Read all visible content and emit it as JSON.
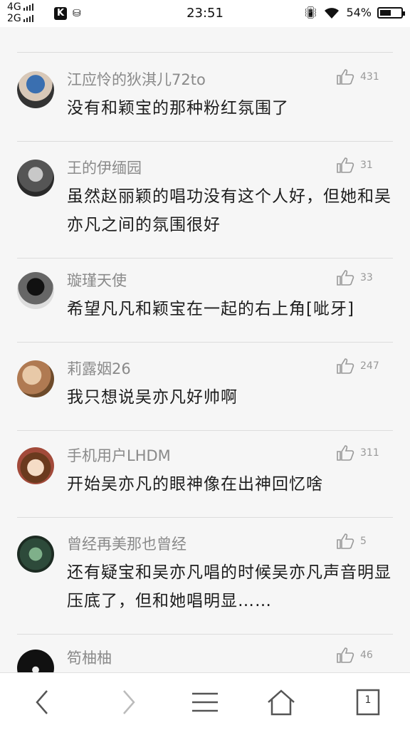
{
  "status_bar": {
    "network_1": "4G",
    "network_2": "2G",
    "time": "23:51",
    "battery": "54%",
    "battery_level": 0.54
  },
  "comments": [
    {
      "username": "江应怜的狄淇儿72to",
      "likes": "431",
      "text": "没有和颖宝的那种粉红氛围了"
    },
    {
      "username": "王的伊缅园",
      "likes": "31",
      "text": "虽然赵丽颖的唱功没有这个人好，但她和吴亦凡之间的氛围很好"
    },
    {
      "username": "璇瑾天使",
      "likes": "33",
      "text": "希望凡凡和颖宝在一起的右上角[呲牙]"
    },
    {
      "username": "莉露姻26",
      "likes": "247",
      "text": "我只想说吴亦凡好帅啊"
    },
    {
      "username": "手机用户LHDM",
      "likes": "311",
      "text": "开始吴亦凡的眼神像在出神回忆啥"
    },
    {
      "username": "曾经再美那也曾经",
      "likes": "5",
      "text": "还有疑宝和吴亦凡唱的时候吴亦凡声音明显压底了，但和她唱明显……"
    },
    {
      "username": "笱柚柚",
      "likes": "46",
      "text": ""
    }
  ],
  "nav": {
    "page_count": "1"
  }
}
